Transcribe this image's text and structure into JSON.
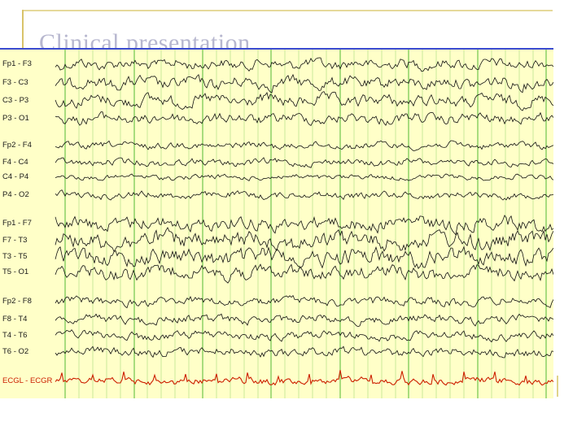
{
  "slide": {
    "title": "Clinical presentation"
  },
  "eeg": {
    "colors": {
      "background": "#ffffc8",
      "grid": "#5fbf3f",
      "trace": "#111111",
      "ecg_trace": "#cc1f00",
      "top_border": "#3a4bd0"
    },
    "channels": [
      "Fp1 - F3",
      "F3 - C3",
      "C3 - P3",
      "P3 - O1",
      "Fp2 - F4",
      "F4 - C4",
      "C4 - P4",
      "P4 - O2",
      "Fp1 - F7",
      "F7 - T3",
      "T3 - T5",
      "T5 - O1",
      "Fp2 - F8",
      "F8 - T4",
      "T4 - T6",
      "T6 - O2",
      "ECGL - ECGR"
    ]
  }
}
